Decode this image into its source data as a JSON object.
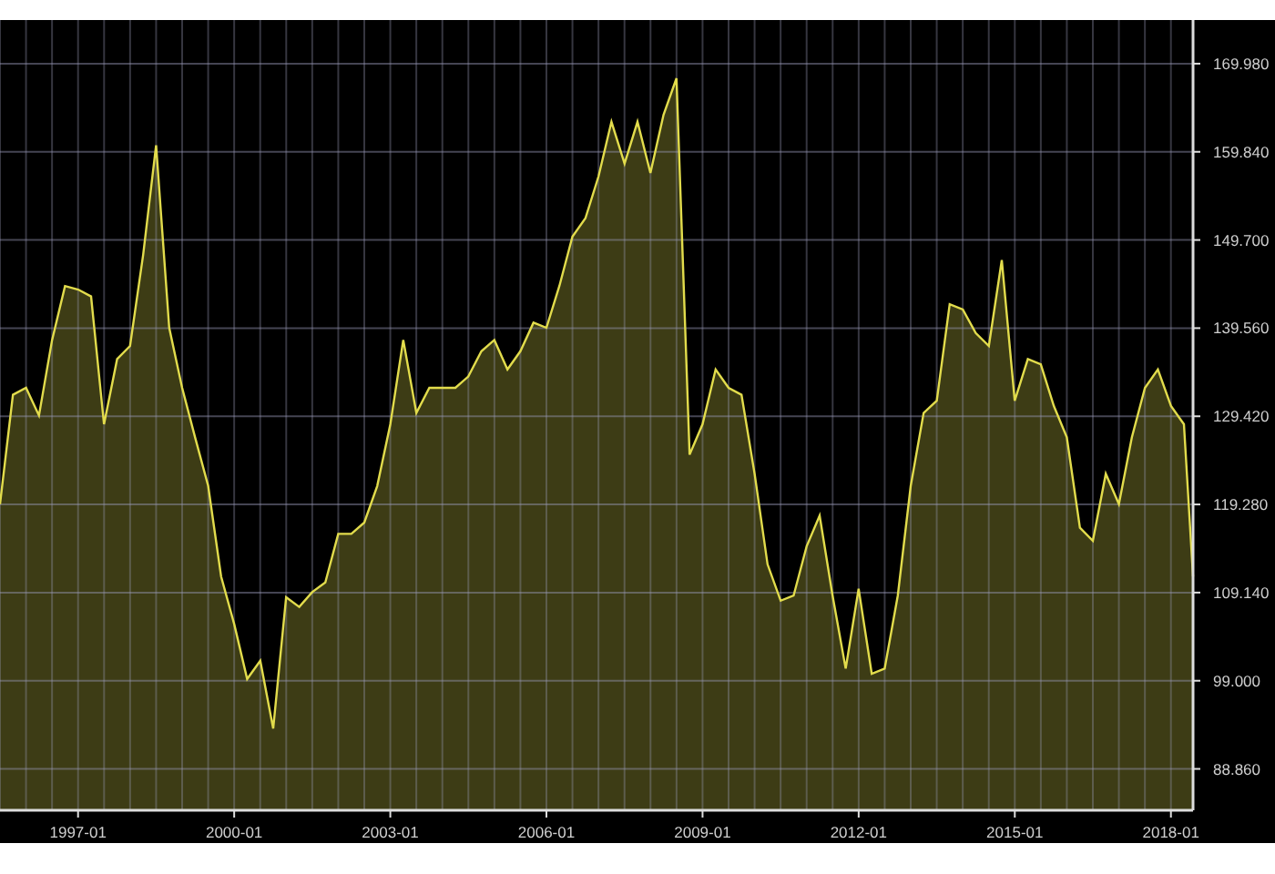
{
  "chart_data": {
    "type": "area",
    "grid": true,
    "ylim": [
      84.1,
      175.0
    ],
    "categories": [
      null,
      null,
      null,
      null,
      null,
      null,
      "1997-01",
      null,
      null,
      null,
      null,
      null,
      null,
      null,
      null,
      null,
      null,
      null,
      "2000-01",
      null,
      null,
      null,
      null,
      null,
      null,
      null,
      null,
      null,
      null,
      null,
      "2003-01",
      null,
      null,
      null,
      null,
      null,
      null,
      null,
      null,
      null,
      null,
      null,
      "2006-01",
      null,
      null,
      null,
      null,
      null,
      null,
      null,
      null,
      null,
      null,
      null,
      "2009-01",
      null,
      null,
      null,
      null,
      null,
      null,
      null,
      null,
      null,
      null,
      null,
      "2012-01",
      null,
      null,
      null,
      null,
      null,
      null,
      null,
      null,
      null,
      null,
      null,
      "2015-01",
      null,
      null,
      null,
      null,
      null,
      null,
      null,
      null,
      null,
      null,
      null,
      "2018-01",
      null,
      null
    ],
    "yticks": [
      {
        "value": 88.86,
        "label": "88.860"
      },
      {
        "value": 99,
        "label": "99.000"
      },
      {
        "value": 109.14,
        "label": "109.140"
      },
      {
        "value": 119.28,
        "label": "119.280"
      },
      {
        "value": 129.42,
        "label": "129.420"
      },
      {
        "value": 139.56,
        "label": "139.560"
      },
      {
        "value": 149.7,
        "label": "149.700"
      },
      {
        "value": 159.84,
        "label": "159.840"
      },
      {
        "value": 169.98,
        "label": "169.980"
      }
    ],
    "series": [
      {
        "color": "#e2dc4c",
        "values": [
          119.3,
          131.9,
          132.7,
          129.5,
          138.2,
          144.4,
          144,
          143.2,
          128.5,
          136,
          137.5,
          148,
          160.6,
          139.6,
          132.7,
          127,
          121.4,
          111,
          105.5,
          99.2,
          101.3,
          93.5,
          108.6,
          107.5,
          109.2,
          110.3,
          115.9,
          115.9,
          117.2,
          121.4,
          128.5,
          138.2,
          129.8,
          132.7,
          132.7,
          132.7,
          134,
          136.9,
          138.2,
          134.8,
          136.9,
          140.2,
          139.6,
          144.4,
          150.1,
          152.2,
          157,
          163.3,
          158.5,
          163.3,
          157.4,
          164.1,
          168.3,
          125,
          128.5,
          134.8,
          132.7,
          131.9,
          122.8,
          112.4,
          108.2,
          108.8,
          114.5,
          118,
          108.8,
          100.4,
          109.6,
          99.8,
          100.4,
          108.8,
          121.4,
          129.8,
          131.2,
          142.3,
          141.7,
          139,
          137.5,
          147.4,
          131.2,
          136,
          135.4,
          130.6,
          127,
          116.6,
          115.1,
          122.8,
          119.3,
          127,
          132.7,
          134.8,
          130.6,
          128.5,
          111
        ]
      }
    ]
  }
}
